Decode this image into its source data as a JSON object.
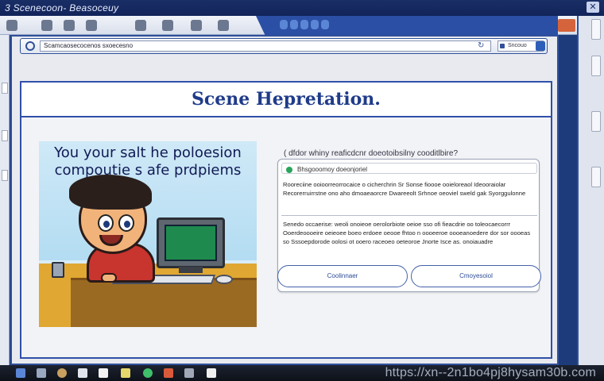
{
  "os_top": {
    "title": "3 Scenecoon-  Beasoceuy"
  },
  "browser": {
    "url": "Scamcaosecocenos sxoecesno",
    "menu_label": "Sncouo"
  },
  "page": {
    "title": "Scene Hepretation.",
    "headline_line1": "You your salt he poloesion",
    "headline_line2": "compoutie s afe prdpiems"
  },
  "panel": {
    "intro": "( dfdor whiny reaficdcnr doeotoibsilny  cooditlbire?",
    "status": "Bhsgooomoy doeonjoriel",
    "para1": "Rooreciine ooioorreorrocaice o cicherchrin Sr Sonse fioooe ooieloreaol Ideooraiolar Recorerruirrstne ono aho dmoaeaorcre Dwareeolt Srhnoe oeoviel sweld gak Syorggulonne",
    "para2": "Senedo occaerise: weoli onoieoe oerolorbiote oeioe sso ofi fieacdrie oo toleocaecorrr Ooerdeoooeire oeieoee boeo erdoee oeooe fhtoo n oooeeroe oooeanoedere dor sor oooeas so Sssoepdorode oolosi ot ooero raceoeo oeteoroe Jnorte Isce as.  onoiauadre",
    "button_left": "Coolinnaer",
    "button_right": "Cmoyesoiol"
  },
  "taskbar": {
    "watermark": "https://xn--2n1bo4pj8hysam30b.com"
  },
  "colors": {
    "accent": "#1f3b8a",
    "status_green": "#2aa45a",
    "frame_blue": "#3050a8"
  }
}
